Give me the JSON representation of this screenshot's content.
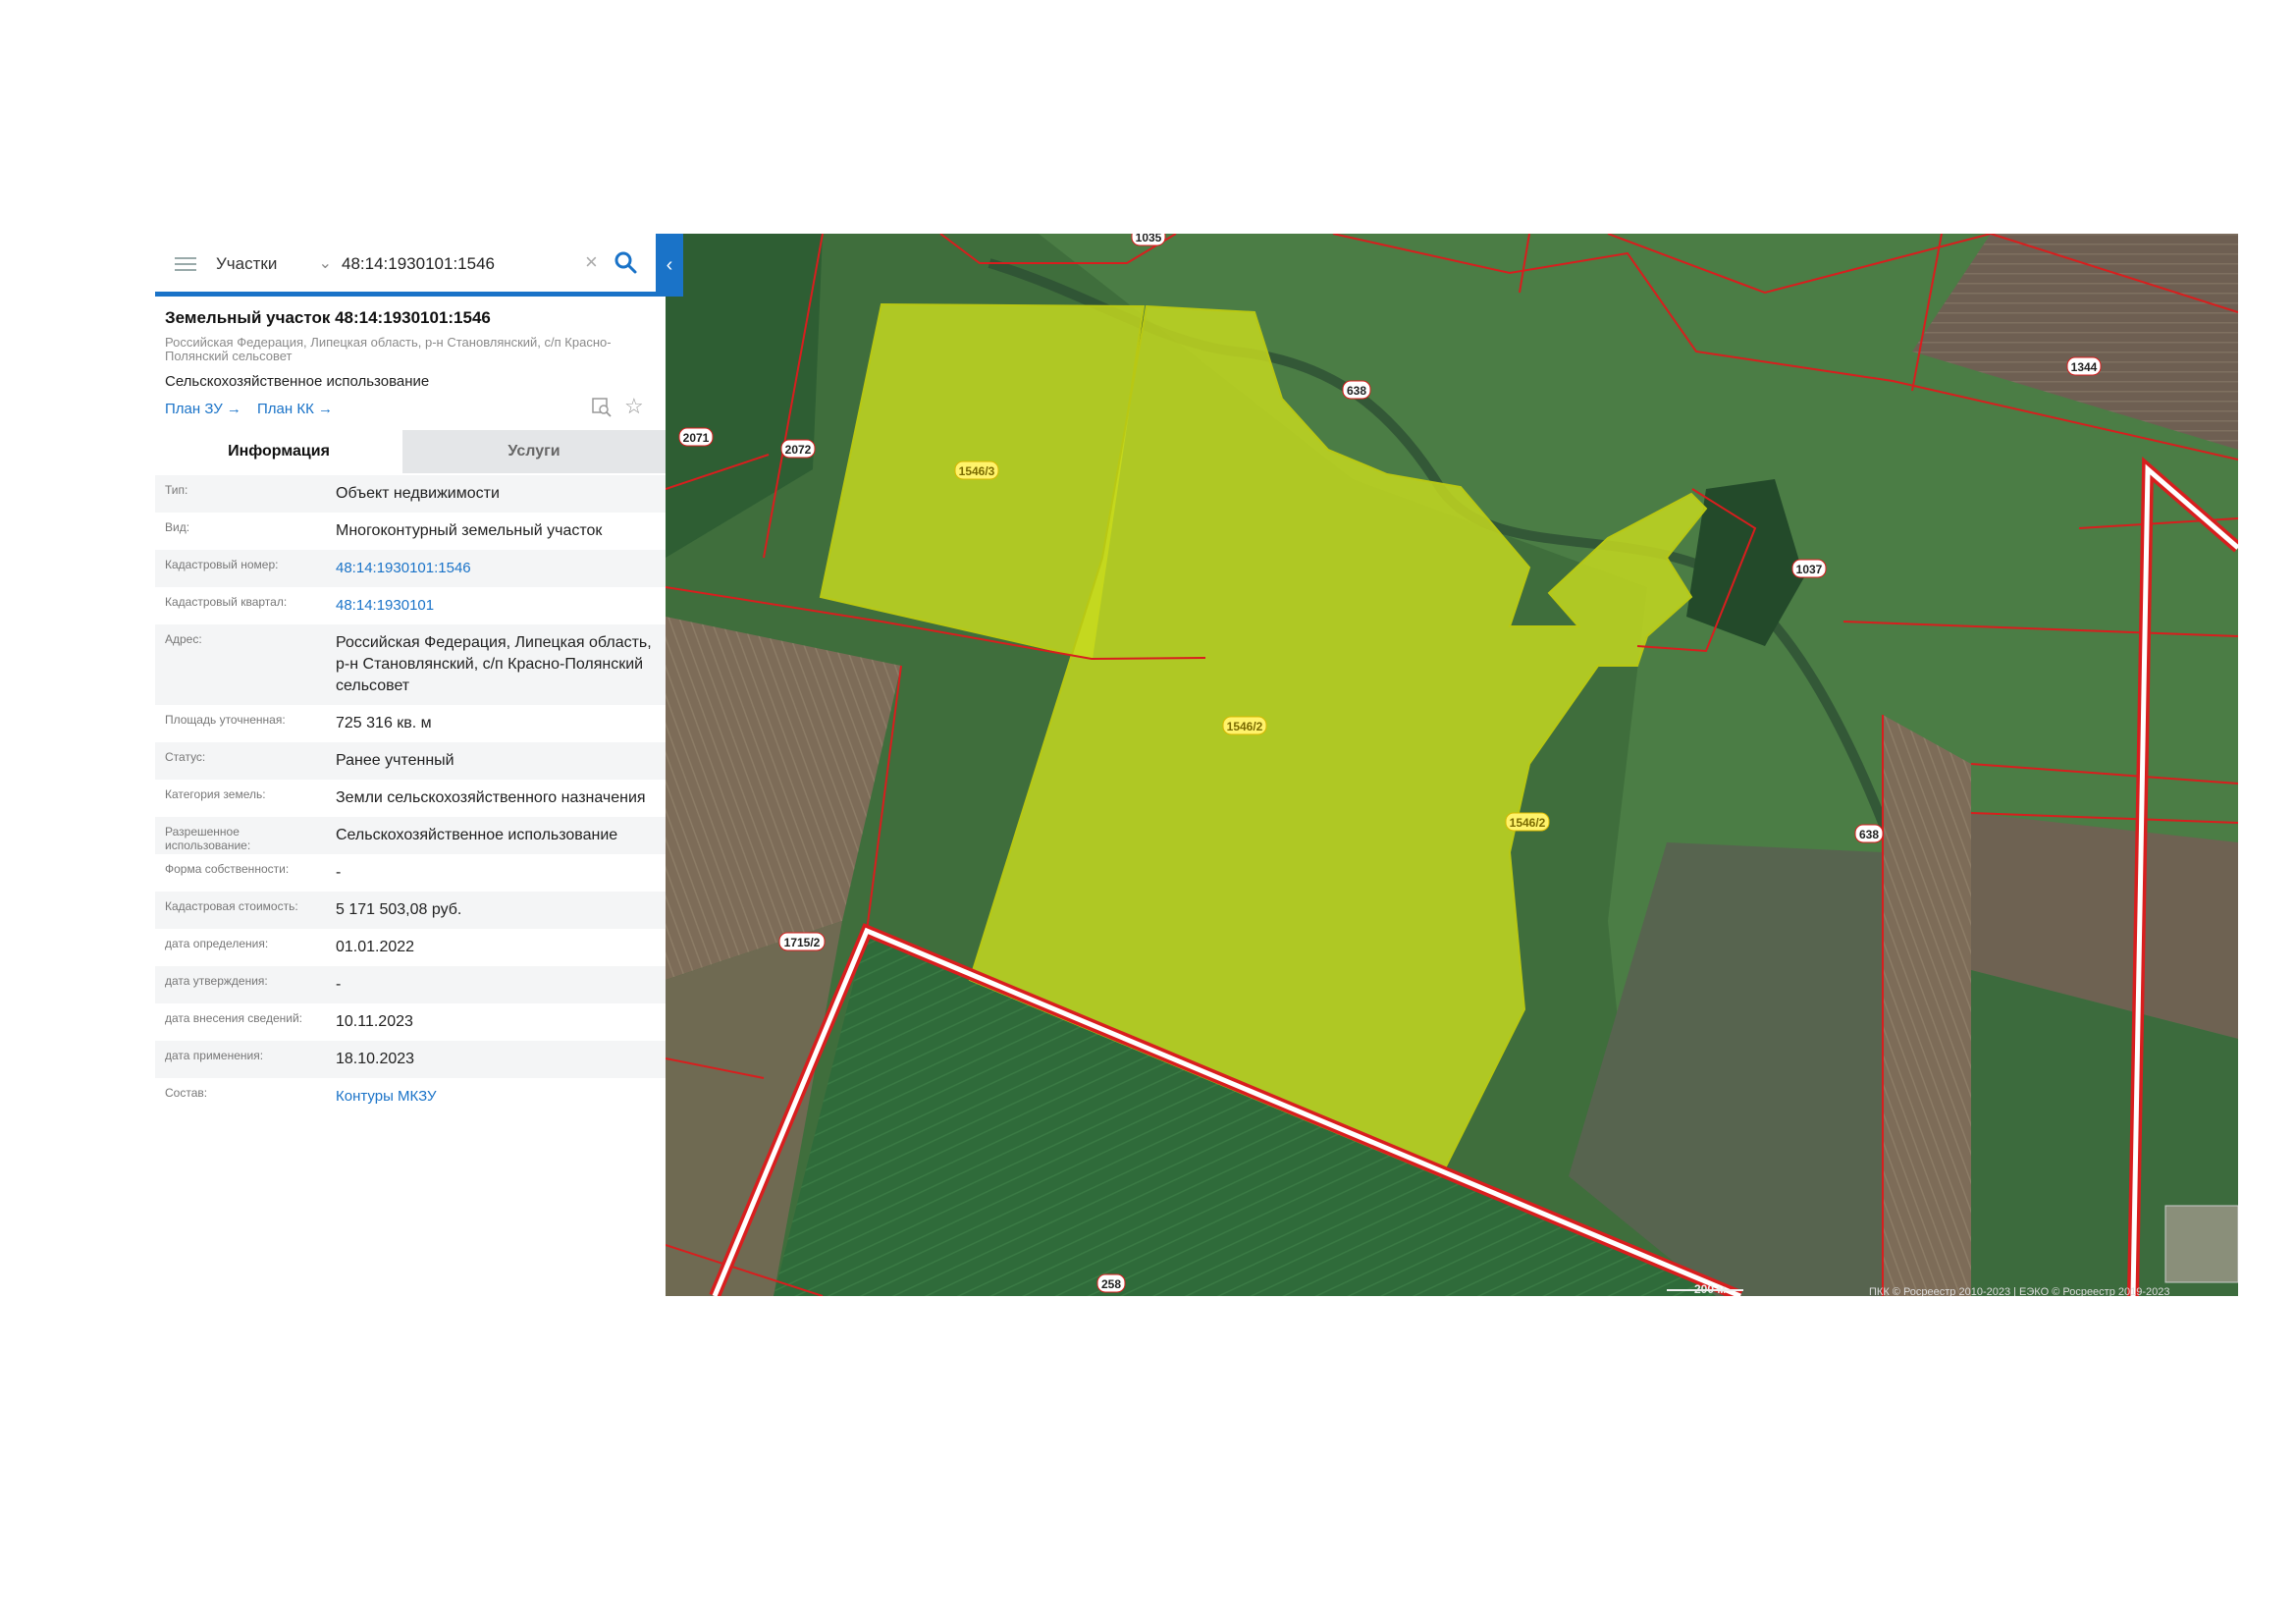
{
  "search": {
    "layer": "Участки",
    "query": "48:14:1930101:1546"
  },
  "parcel": {
    "title": "Земельный участок 48:14:1930101:1546",
    "address": "Российская Федерация, Липецкая область, р-н Становлянский, с/п Красно-Полянский сельсовет",
    "use": "Сельскохозяйственное использование",
    "plan_zu": "План ЗУ →",
    "plan_kk": "План КК →"
  },
  "tabs": {
    "info": "Информация",
    "services": "Услуги"
  },
  "info_rows": [
    {
      "label": "Тип:",
      "value": "Объект недвижимости"
    },
    {
      "label": "Вид:",
      "value": "Многоконтурный земельный участок"
    },
    {
      "label": "Кадастровый номер:",
      "value": "48:14:1930101:1546"
    },
    {
      "label": "Кадастровый квартал:",
      "value": "48:14:1930101"
    },
    {
      "label": "Адрес:",
      "value": "Российская Федерация, Липецкая область, р-н Становлянский, с/п Красно-Полянский сельсовет"
    },
    {
      "label": "Площадь уточненная:",
      "value": "725 316 кв. м"
    },
    {
      "label": "Статус:",
      "value": "Ранее учтенный"
    },
    {
      "label": "Категория земель:",
      "value": "Земли сельскохозяйственного назначения"
    },
    {
      "label": "Разрешенное использование:",
      "value": "Сельскохозяйственное использование"
    },
    {
      "label": "Форма собственности:",
      "value": "-"
    },
    {
      "label": "Кадастровая стоимость:",
      "value": "5 171 503,08 руб."
    },
    {
      "label": "дата определения:",
      "value": "01.01.2022"
    },
    {
      "label": "дата утверждения:",
      "value": "-"
    },
    {
      "label": "дата внесения сведений:",
      "value": "10.11.2023"
    },
    {
      "label": "дата применения:",
      "value": "18.10.2023"
    },
    {
      "label": "Состав:",
      "value": "Контуры МКЗУ"
    }
  ],
  "map": {
    "labels": {
      "l1035": "1035",
      "l638a": "638",
      "l1344": "1344",
      "l2071": "2071",
      "l2072": "2072",
      "l1546_3": "1546/3",
      "l1037": "1037",
      "l1546_2a": "1546/2",
      "l1546_2b": "1546/2",
      "l638b": "638",
      "l1715_2": "1715/2",
      "l258": "258"
    },
    "scale": "200 м",
    "attribution": "ПКК © Росреестр 2010-2023 | ЕЭКО © Росреестр 2019-2023",
    "colors": {
      "highlight": "#c8dc1e",
      "boundary": "#d81e1e",
      "label_bg": "#ffffff"
    }
  }
}
